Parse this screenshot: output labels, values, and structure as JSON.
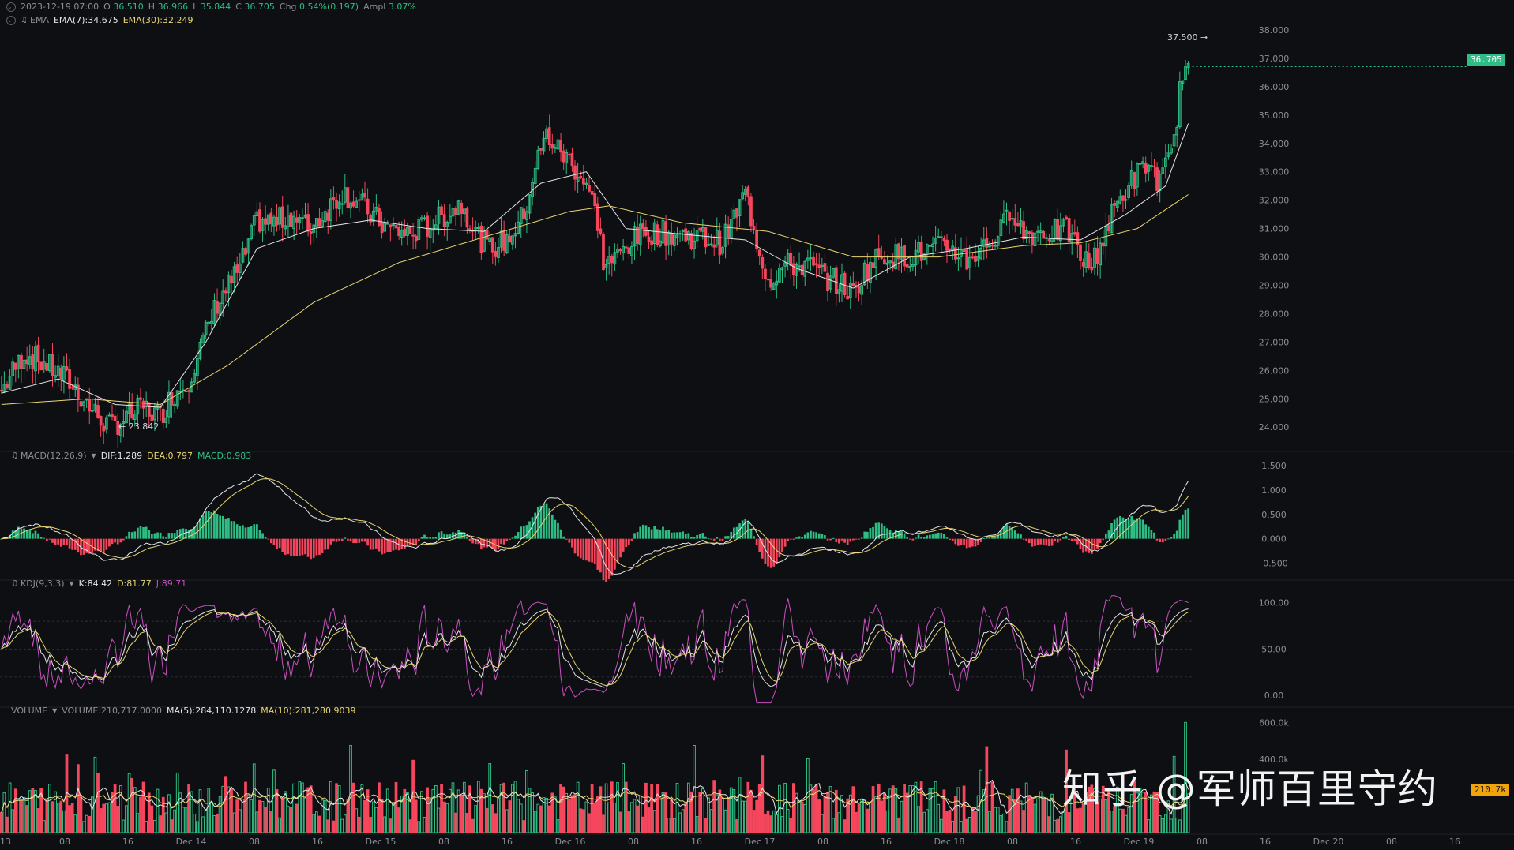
{
  "header": {
    "datetime": "2023-12-19 07:00",
    "open_label": "O",
    "open": "36.510",
    "high_label": "H",
    "high": "36.966",
    "low_label": "L",
    "low": "35.844",
    "close_label": "C",
    "close": "36.705",
    "chg_label": "Chg",
    "chg": "0.54%(0.197)",
    "ampl_label": "Ampl",
    "ampl": "3.07%"
  },
  "ema_legend": {
    "name": "EMA",
    "ema7": "EMA(7):34.675",
    "ema30": "EMA(30):32.249"
  },
  "macd_legend": {
    "name": "MACD(12,26,9)",
    "dif": "DIF:1.289",
    "dea": "DEA:0.797",
    "macd": "MACD:0.983"
  },
  "kdj_legend": {
    "name": "KDJ(9,3,3)",
    "k": "K:84.42",
    "d": "D:81.77",
    "j": "J:89.71"
  },
  "volume_legend": {
    "name": "VOLUME",
    "vol": "VOLUME:210,717.0000",
    "ma5": "MA(5):284,110.1278",
    "ma10": "MA(10):281,280.9039"
  },
  "annotations": {
    "high_marker": "37.500",
    "low_marker": "23.842"
  },
  "price_tags": {
    "last_price": "36.705",
    "last_volume": "210.7k"
  },
  "watermark": "知乎 @军师百里守约",
  "colors": {
    "background": "#0e0f12",
    "up": "#2ebd85",
    "down": "#f6465d",
    "ema7": "#e6e6e6",
    "ema30": "#e8d670",
    "macd_dea": "#e8d670",
    "kdj_j": "#c850c0",
    "last_price_tag": "#2ebd85",
    "volume_tag": "#f0a30a"
  },
  "chart_data": {
    "type": "candlestick",
    "interval": "1h",
    "price_axis": {
      "ticks": [
        "24.000",
        "25.000",
        "26.000",
        "27.000",
        "28.000",
        "29.000",
        "30.000",
        "31.000",
        "32.000",
        "33.000",
        "34.000",
        "35.000",
        "36.000",
        "37.000",
        "38.000"
      ],
      "range": [
        23.2,
        38.5
      ]
    },
    "macd_axis": {
      "ticks": [
        "-0.500",
        "0.000",
        "0.500",
        "1.000",
        "1.500"
      ],
      "range": [
        -0.8,
        1.6
      ]
    },
    "kdj_axis": {
      "ticks": [
        "0.00",
        "50.00",
        "100.00"
      ],
      "range": [
        -10,
        115
      ]
    },
    "volume_axis": {
      "ticks": [
        "400.0k",
        "600.0k"
      ],
      "range": [
        0,
        640000
      ]
    },
    "time_axis": {
      "labels": [
        "13",
        "08",
        "16",
        "Dec 14",
        "08",
        "16",
        "Dec 15",
        "08",
        "16",
        "Dec 16",
        "08",
        "16",
        "Dec 17",
        "08",
        "16",
        "Dec 18",
        "08",
        "16",
        "Dec 19",
        "08",
        "16",
        "Dec 20",
        "08",
        "16"
      ]
    },
    "price_path": [
      [
        0,
        25.3
      ],
      [
        8,
        26.6
      ],
      [
        16,
        26.2
      ],
      [
        24,
        25.6
      ],
      [
        32,
        24.6
      ],
      [
        38,
        24.0
      ],
      [
        45,
        24.4
      ],
      [
        50,
        24.7
      ],
      [
        56,
        24.4
      ],
      [
        60,
        25.1
      ],
      [
        66,
        25.7
      ],
      [
        72,
        27.3
      ],
      [
        76,
        28.4
      ],
      [
        80,
        29.0
      ],
      [
        84,
        29.6
      ],
      [
        90,
        31.3
      ],
      [
        96,
        31.2
      ],
      [
        102,
        31.5
      ],
      [
        108,
        31.0
      ],
      [
        114,
        31.6
      ],
      [
        120,
        32.3
      ],
      [
        126,
        31.9
      ],
      [
        130,
        31.5
      ],
      [
        136,
        31.0
      ],
      [
        144,
        30.8
      ],
      [
        152,
        31.2
      ],
      [
        158,
        31.6
      ],
      [
        162,
        31.9
      ],
      [
        168,
        30.7
      ],
      [
        172,
        30.3
      ],
      [
        178,
        30.6
      ],
      [
        184,
        31.5
      ],
      [
        188,
        33.2
      ],
      [
        192,
        34.3
      ],
      [
        196,
        33.8
      ],
      [
        200,
        33.4
      ],
      [
        206,
        32.6
      ],
      [
        210,
        31.3
      ],
      [
        212,
        29.8
      ],
      [
        216,
        29.9
      ],
      [
        222,
        30.6
      ],
      [
        228,
        30.9
      ],
      [
        236,
        30.8
      ],
      [
        246,
        30.7
      ],
      [
        254,
        30.5
      ],
      [
        260,
        31.8
      ],
      [
        262,
        32.3
      ],
      [
        266,
        30.6
      ],
      [
        270,
        29.2
      ],
      [
        276,
        29.7
      ],
      [
        284,
        29.7
      ],
      [
        290,
        29.3
      ],
      [
        296,
        29.0
      ],
      [
        300,
        28.7
      ],
      [
        304,
        29.5
      ],
      [
        310,
        30.1
      ],
      [
        318,
        30.0
      ],
      [
        326,
        30.2
      ],
      [
        334,
        30.4
      ],
      [
        340,
        29.9
      ],
      [
        348,
        30.5
      ],
      [
        352,
        30.9
      ],
      [
        356,
        31.8
      ],
      [
        360,
        30.8
      ],
      [
        368,
        30.9
      ],
      [
        376,
        30.9
      ],
      [
        380,
        30.0
      ],
      [
        384,
        29.7
      ],
      [
        388,
        30.7
      ],
      [
        392,
        31.7
      ],
      [
        398,
        32.7
      ],
      [
        404,
        33.3
      ],
      [
        408,
        32.6
      ],
      [
        412,
        33.6
      ],
      [
        414,
        35.0
      ],
      [
        416,
        36.6
      ],
      [
        418,
        36.7
      ]
    ],
    "ema7_path": [
      [
        0,
        25.2
      ],
      [
        20,
        25.7
      ],
      [
        40,
        24.8
      ],
      [
        56,
        24.7
      ],
      [
        72,
        27.0
      ],
      [
        90,
        30.3
      ],
      [
        110,
        31.0
      ],
      [
        130,
        31.3
      ],
      [
        150,
        31.0
      ],
      [
        170,
        30.9
      ],
      [
        190,
        32.6
      ],
      [
        206,
        33.0
      ],
      [
        220,
        31.0
      ],
      [
        240,
        30.8
      ],
      [
        262,
        30.6
      ],
      [
        280,
        29.6
      ],
      [
        300,
        28.9
      ],
      [
        320,
        30.0
      ],
      [
        340,
        30.3
      ],
      [
        360,
        30.7
      ],
      [
        380,
        30.6
      ],
      [
        396,
        31.5
      ],
      [
        410,
        32.5
      ],
      [
        418,
        34.7
      ]
    ],
    "ema30_path": [
      [
        0,
        24.8
      ],
      [
        30,
        25.0
      ],
      [
        56,
        24.8
      ],
      [
        80,
        26.2
      ],
      [
        110,
        28.4
      ],
      [
        140,
        29.8
      ],
      [
        170,
        30.7
      ],
      [
        200,
        31.6
      ],
      [
        214,
        31.8
      ],
      [
        240,
        31.2
      ],
      [
        270,
        30.9
      ],
      [
        300,
        30.0
      ],
      [
        330,
        30.0
      ],
      [
        360,
        30.4
      ],
      [
        380,
        30.5
      ],
      [
        400,
        31.0
      ],
      [
        418,
        32.2
      ]
    ]
  }
}
